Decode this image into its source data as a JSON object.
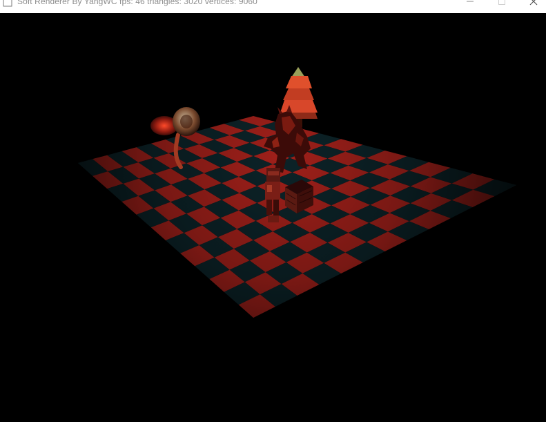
{
  "window": {
    "title": "Soft Renderer By YangWC  fps: 46 triangles: 3020 vertices: 9060",
    "icon": "app-window-icon",
    "controls": [
      "minimize-icon",
      "maximize-icon",
      "close-icon"
    ]
  },
  "scene": {
    "floor": {
      "rows": 12,
      "cols": 12,
      "colors": {
        "lit": "#a0201a",
        "dark": "#0c2328"
      }
    },
    "objects": [
      "tree",
      "creature",
      "character",
      "crate",
      "mushroom"
    ]
  }
}
